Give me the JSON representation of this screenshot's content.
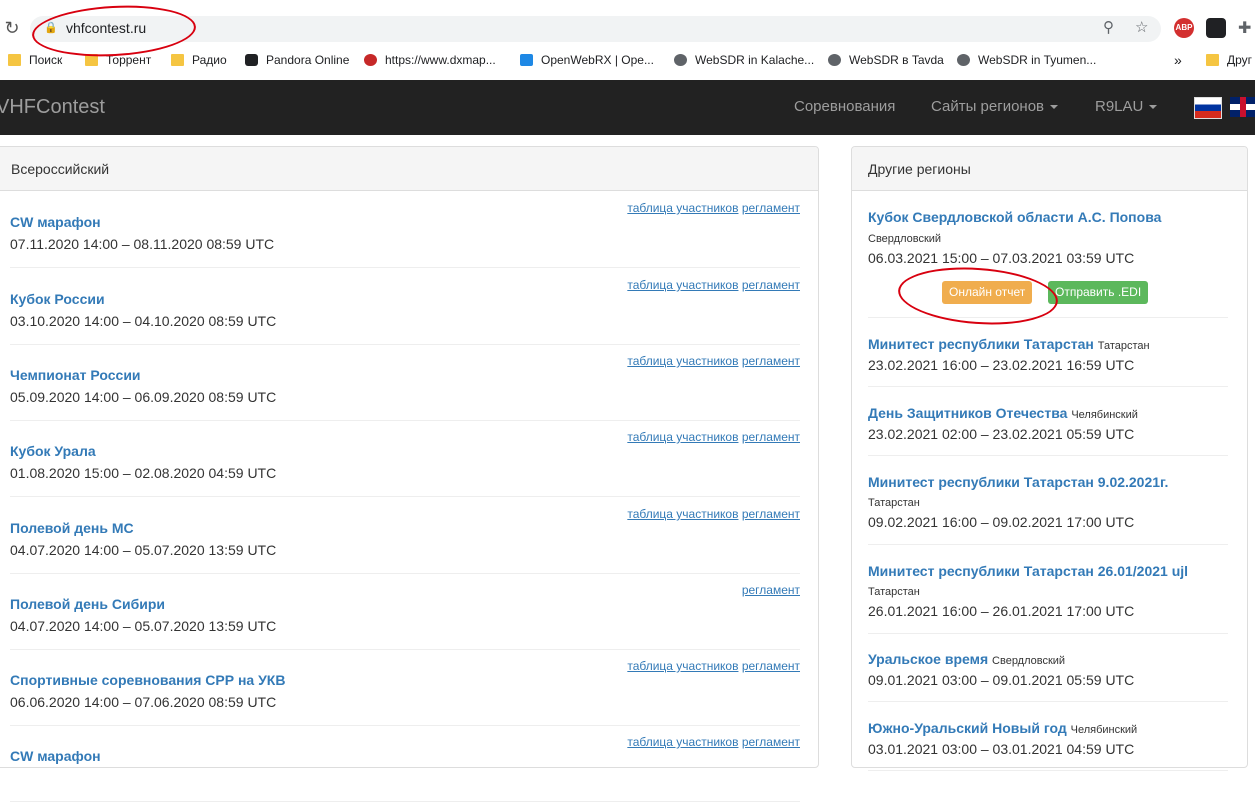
{
  "browser": {
    "url": "vhfcontest.ru",
    "bookmarks": [
      {
        "label": "Поиск",
        "icon": "folder-icon"
      },
      {
        "label": "Торрент",
        "icon": "folder-icon"
      },
      {
        "label": "Радио",
        "icon": "folder-icon"
      },
      {
        "label": "Pandora Online",
        "icon": "lock-icon"
      },
      {
        "label": "https://www.dxmap...",
        "icon": "dxmap-icon"
      },
      {
        "label": "OpenWebRX | Ope...",
        "icon": "openwebrx-icon"
      },
      {
        "label": "WebSDR in Kalache...",
        "icon": "globe-icon"
      },
      {
        "label": "WebSDR в Tavda",
        "icon": "globe-icon"
      },
      {
        "label": "WebSDR in Tyumen...",
        "icon": "globe-icon"
      },
      {
        "label": "Друг",
        "icon": "folder-icon"
      }
    ],
    "more_bookmarks": "»",
    "ext_abp": "ABP"
  },
  "navbar": {
    "brand": "VHFContest",
    "links": [
      "Соревнования",
      "Сайты регионов",
      "R9LAU"
    ]
  },
  "main_panel": {
    "heading": "Всероссийский",
    "link_participants": "таблица участников",
    "link_rules": "регламент",
    "items": [
      {
        "title": "CW марафон",
        "dates": "07.11.2020 14:00 – 08.11.2020 08:59 UTC"
      },
      {
        "title": "Кубок России",
        "dates": "03.10.2020 14:00 – 04.10.2020 08:59 UTC"
      },
      {
        "title": "Чемпионат России",
        "dates": "05.09.2020 14:00 – 06.09.2020 08:59 UTC"
      },
      {
        "title": "Кубок Урала",
        "dates": "01.08.2020 15:00 – 02.08.2020 04:59 UTC"
      },
      {
        "title": "Полевой день МС",
        "dates": "04.07.2020 14:00 – 05.07.2020 13:59 UTC"
      },
      {
        "title": "Полевой день Сибири",
        "dates": "04.07.2020 14:00 – 05.07.2020 13:59 UTC"
      },
      {
        "title": "Спортивные соревнования СРР на УКВ",
        "dates": "06.06.2020 14:00 – 07.06.2020 08:59 UTC"
      },
      {
        "title": "CW марафон",
        "dates": ""
      }
    ]
  },
  "side_panel": {
    "heading": "Другие регионы",
    "featured": {
      "title": "Кубок Свердловской области А.С. Попова",
      "region": "Свердловский",
      "dates": "06.03.2021 15:00 – 07.03.2021 03:59 UTC",
      "btn_report": "Онлайн отчет",
      "btn_edi": "Отправить .EDI"
    },
    "items": [
      {
        "title": "Минитест республики Татарстан",
        "region": "Татарстан",
        "dates": "23.02.2021 16:00 – 23.02.2021 16:59 UTC"
      },
      {
        "title": "День Защитников Отечества",
        "region": "Челябинский",
        "dates": "23.02.2021 02:00 – 23.02.2021 05:59 UTC"
      },
      {
        "title": "Минитест республики Татарстан 9.02.2021г.",
        "region": "Татарстан",
        "dates": "09.02.2021 16:00 – 09.02.2021 17:00 UTC"
      },
      {
        "title": "Минитест республики Татарстан 26.01/2021 ujl",
        "region": "Татарстан",
        "dates": "26.01.2021 16:00 – 26.01.2021 17:00 UTC"
      },
      {
        "title": "Уральское время",
        "region": "Свердловский",
        "dates": "09.01.2021 03:00 – 09.01.2021 05:59 UTC"
      },
      {
        "title": "Южно-Уральский Новый год",
        "region": "Челябинский",
        "dates": "03.01.2021 03:00 – 03.01.2021 04:59 UTC"
      }
    ]
  }
}
